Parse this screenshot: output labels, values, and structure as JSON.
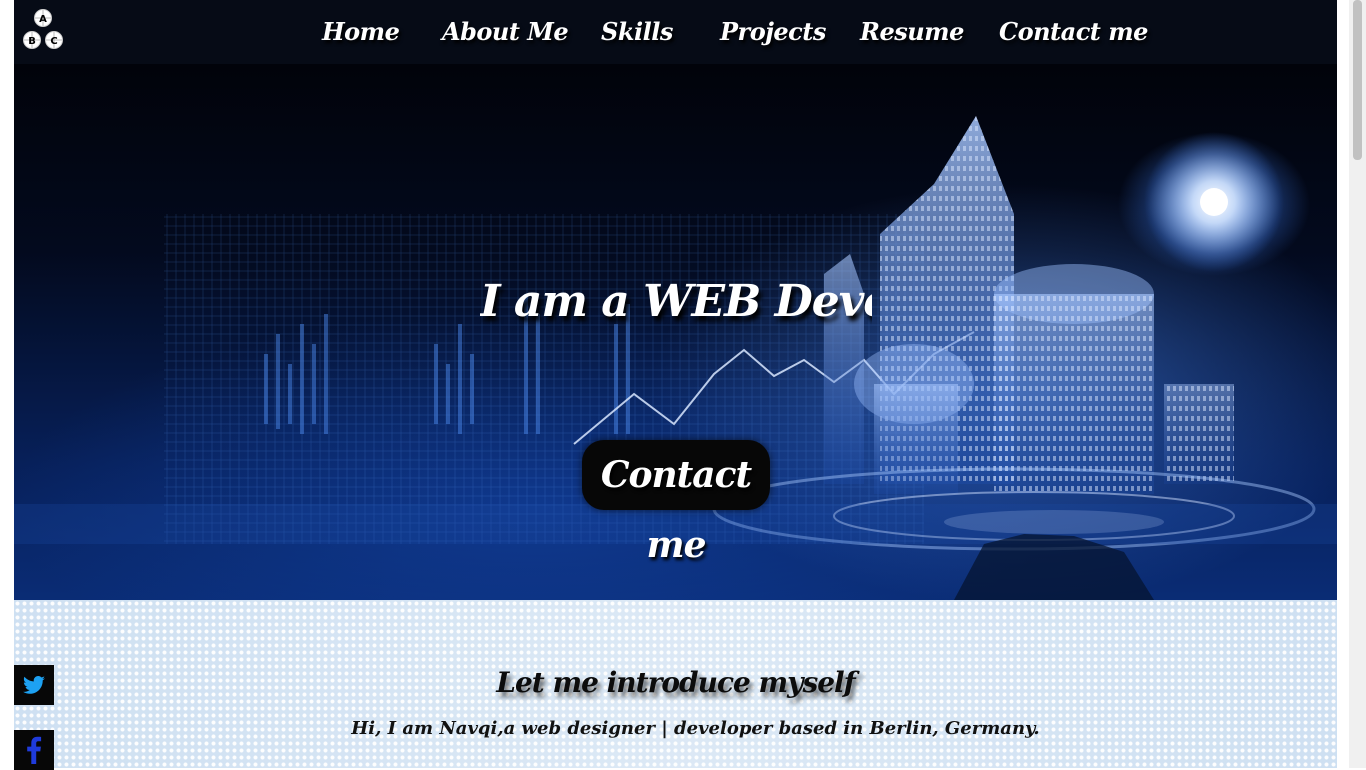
{
  "logo": {
    "letters": [
      "A",
      "B",
      "C"
    ]
  },
  "nav": {
    "items": [
      {
        "label": "Home"
      },
      {
        "label": "About Me"
      },
      {
        "label": "Skills"
      },
      {
        "label": "Projects"
      },
      {
        "label": "Resume"
      },
      {
        "label": "Contact me"
      }
    ]
  },
  "hero": {
    "title": "I am a WEB Developer",
    "button": "Contact me"
  },
  "intro": {
    "title": "Let me introduce myself",
    "text": "Hi, I am Navqi,a web designer | developer based in Berlin, Germany."
  },
  "social": {
    "items": [
      {
        "icon": "twitter-icon",
        "color": "#1da1f2"
      },
      {
        "icon": "facebook-icon",
        "color": "#1f3bdc"
      }
    ]
  },
  "colors": {
    "nav_bg": "#060b16",
    "button_bg": "#070707",
    "text_light": "#ffffff"
  }
}
